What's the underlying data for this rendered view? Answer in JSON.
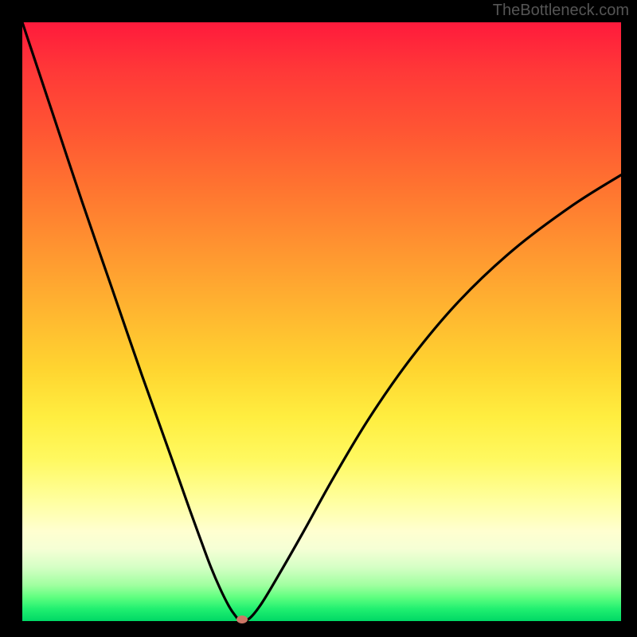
{
  "watermark": "TheBottleneck.com",
  "chart_data": {
    "type": "line",
    "title": "",
    "xlabel": "",
    "ylabel": "",
    "xlim": [
      0,
      100
    ],
    "ylim": [
      0,
      100
    ],
    "series": [
      {
        "name": "curve",
        "x": [
          0,
          5,
          10,
          15,
          20,
          25,
          28,
          30,
          31.5,
          33,
          34.5,
          35.5,
          36.5,
          38,
          40,
          43,
          47,
          52,
          58,
          65,
          73,
          82,
          92,
          100
        ],
        "y": [
          100,
          85,
          70,
          55.5,
          41,
          27,
          18.5,
          13,
          9,
          5.5,
          2.5,
          1,
          0,
          0.5,
          3,
          8,
          15,
          24,
          34,
          44,
          53.5,
          62,
          69.5,
          74.5
        ]
      }
    ],
    "marker": {
      "x": 36.7,
      "y": 0.3
    },
    "gradient_stops": [
      {
        "pos": 0,
        "color": "#ff1a3c"
      },
      {
        "pos": 50,
        "color": "#ffd530"
      },
      {
        "pos": 85,
        "color": "#ffffd0"
      },
      {
        "pos": 100,
        "color": "#00d865"
      }
    ]
  }
}
